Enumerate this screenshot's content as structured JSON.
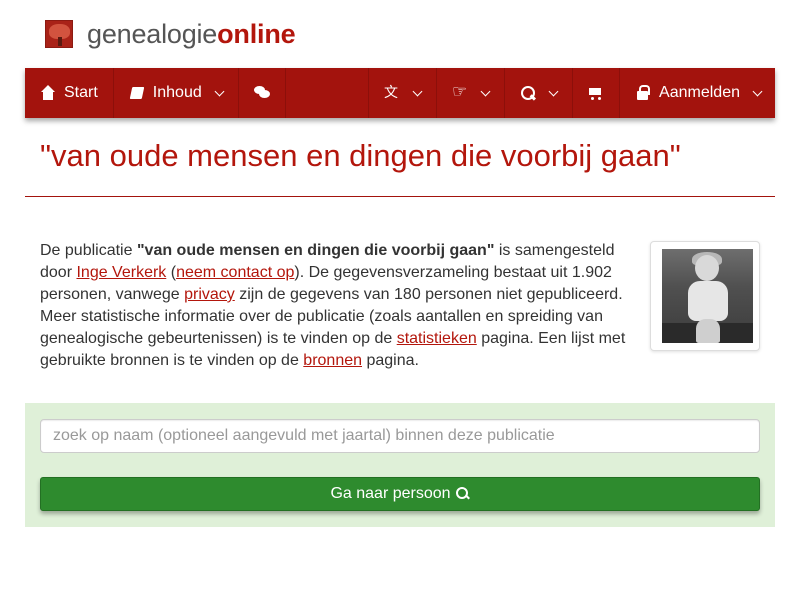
{
  "logo": {
    "text_plain": "genealogie",
    "text_bold": "online",
    "icon": "tree-icon"
  },
  "nav": {
    "start": {
      "label": "Start",
      "icon": "home-icon"
    },
    "inhoud": {
      "label": "Inhoud",
      "icon": "book-icon"
    },
    "forum": {
      "icon": "chat-icon"
    },
    "language": {
      "icon": "language-icon"
    },
    "share": {
      "icon": "thumbs-up-icon"
    },
    "search": {
      "icon": "search-icon"
    },
    "shop": {
      "icon": "cart-icon"
    },
    "login": {
      "label": "Aanmelden",
      "icon": "lock-icon"
    }
  },
  "page": {
    "title": "\"van oude mensen en dingen die voorbij gaan\""
  },
  "description": {
    "t1": "De publicatie ",
    "pub_name": "\"van oude mensen en dingen die voorbij gaan\"",
    "t2": " is samengesteld door ",
    "author_link": "Inge Verkerk",
    "t3": " (",
    "contact_link": "neem contact op",
    "t4": "). De gegevensverzameling bestaat uit 1.902 personen, vanwege ",
    "privacy_link": "privacy",
    "t5": " zijn de gegevens van 180 personen niet gepubliceerd. Meer statistische informatie over de publicatie (zoals aantallen en spreiding van genealogische gebeurtenissen) is te vinden op de ",
    "stats_link": "statistieken",
    "t6": " pagina. Een lijst met gebruikte bronnen is te vinden op de ",
    "sources_link": "bronnen",
    "t7": " pagina."
  },
  "search": {
    "placeholder": "zoek op naam (optioneel aangevuld met jaartal) binnen deze publicatie",
    "value": "",
    "button_label": "Ga naar persoon"
  },
  "colors": {
    "brand": "#a3130d",
    "title": "#b3160c",
    "panel": "#dff0d8",
    "button": "#2e8b2e"
  }
}
